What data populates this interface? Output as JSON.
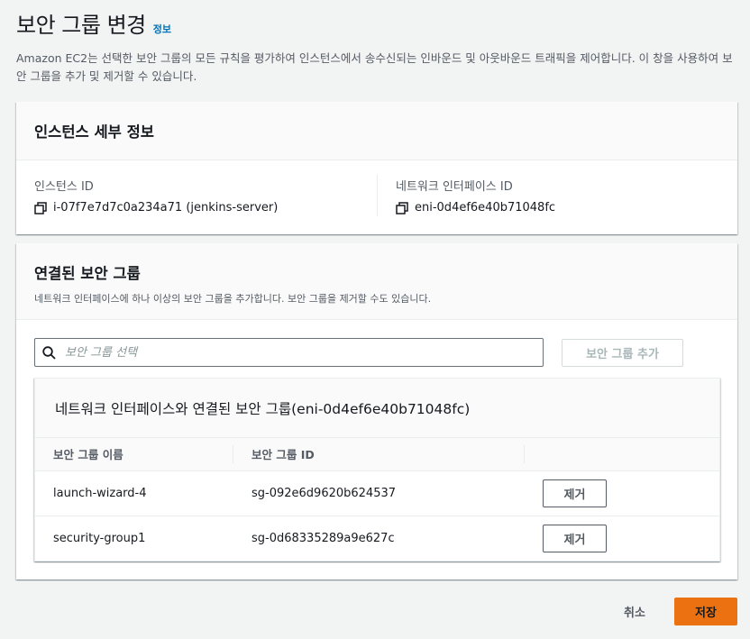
{
  "header": {
    "title": "보안 그룹 변경",
    "info_link": "정보",
    "description": "Amazon EC2는 선택한 보안 그룹의 모든 규칙을 평가하여 인스턴스에서 송수신되는 인바운드 및 아웃바운드 트래픽을 제어합니다. 이 창을 사용하여 보안 그룹을 추가 및 제거할 수 있습니다."
  },
  "instance_panel": {
    "title": "인스턴스 세부 정보",
    "instance_id_label": "인스턴스 ID",
    "instance_id_value": "i-07f7e7d7c0a234a71 (jenkins-server)",
    "eni_label": "네트워크 인터페이스 ID",
    "eni_value": "eni-0d4ef6e40b71048fc"
  },
  "sg_panel": {
    "title": "연결된 보안 그룹",
    "subtitle": "네트워크 인터페이스에 하나 이상의 보안 그룹을 추가합니다. 보안 그룹을 제거할 수도 있습니다.",
    "search_placeholder": "보안 그룹 선택",
    "add_button": "보안 그룹 추가",
    "table": {
      "title": "네트워크 인터페이스와 연결된 보안 그룹(eni-0d4ef6e40b71048fc)",
      "columns": [
        "보안 그룹 이름",
        "보안 그룹 ID",
        ""
      ],
      "rows": [
        {
          "name": "launch-wizard-4",
          "id": "sg-092e6d9620b624537",
          "action": "제거"
        },
        {
          "name": "security-group1",
          "id": "sg-0d68335289a9e627c",
          "action": "제거"
        }
      ]
    }
  },
  "footer": {
    "cancel": "취소",
    "save": "저장"
  },
  "colors": {
    "primary_button": "#ec7211",
    "link": "#0073bb",
    "background": "#f2f3f3"
  }
}
